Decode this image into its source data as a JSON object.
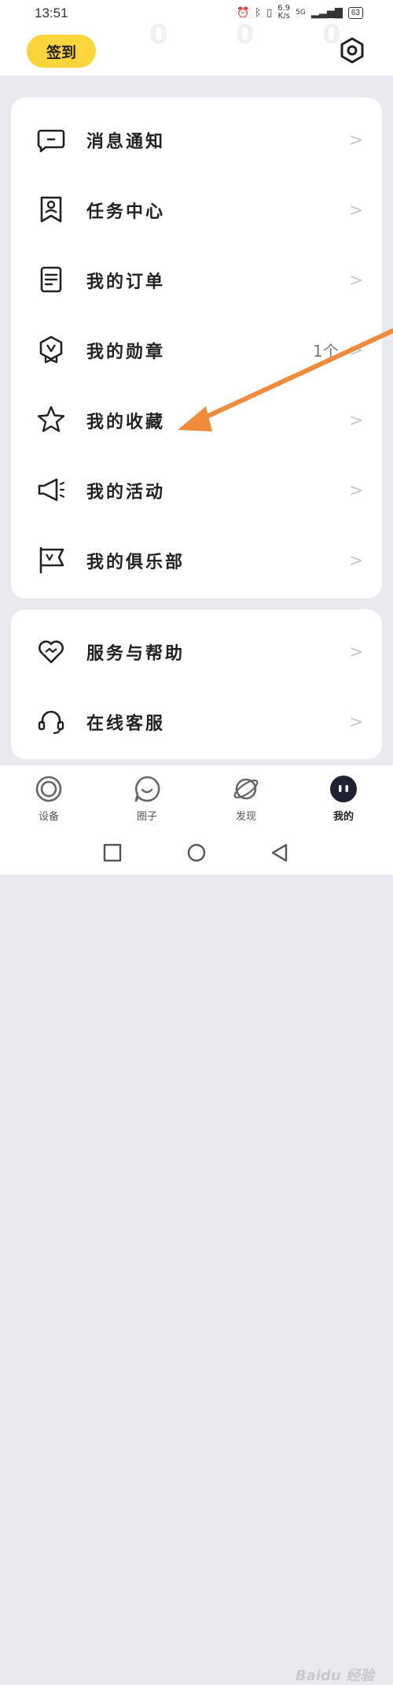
{
  "status_bar": {
    "time": "13:51",
    "speed_value": "6.9",
    "speed_unit": "K/s",
    "signal": "5G",
    "battery": "63"
  },
  "header": {
    "checkin_label": "签到",
    "faded_stat_values": [
      "0",
      "0",
      "0"
    ]
  },
  "menu_main": [
    {
      "label": "消息通知",
      "value": "",
      "icon": "message-icon"
    },
    {
      "label": "任务中心",
      "value": "",
      "icon": "task-center-icon"
    },
    {
      "label": "我的订单",
      "value": "",
      "icon": "order-icon"
    },
    {
      "label": "我的勋章",
      "value": "1个",
      "icon": "medal-icon"
    },
    {
      "label": "我的收藏",
      "value": "",
      "icon": "star-icon"
    },
    {
      "label": "我的活动",
      "value": "",
      "icon": "megaphone-icon"
    },
    {
      "label": "我的俱乐部",
      "value": "",
      "icon": "club-flag-icon"
    }
  ],
  "menu_support": [
    {
      "label": "服务与帮助",
      "value": "",
      "icon": "heart-help-icon"
    },
    {
      "label": "在线客服",
      "value": "",
      "icon": "headset-icon"
    }
  ],
  "bottom_nav": {
    "tabs": [
      {
        "label": "设备",
        "icon": "device-icon",
        "active": false
      },
      {
        "label": "圈子",
        "icon": "circle-community-icon",
        "active": false
      },
      {
        "label": "发现",
        "icon": "discover-planet-icon",
        "active": false
      },
      {
        "label": "我的",
        "icon": "me-face-icon",
        "active": true
      }
    ]
  },
  "watermark": "Baidu 经验",
  "colors": {
    "accent_yellow": "#fbd53b",
    "annotation_arrow": "#f08a3c",
    "page_bg": "#e9eaf0"
  }
}
